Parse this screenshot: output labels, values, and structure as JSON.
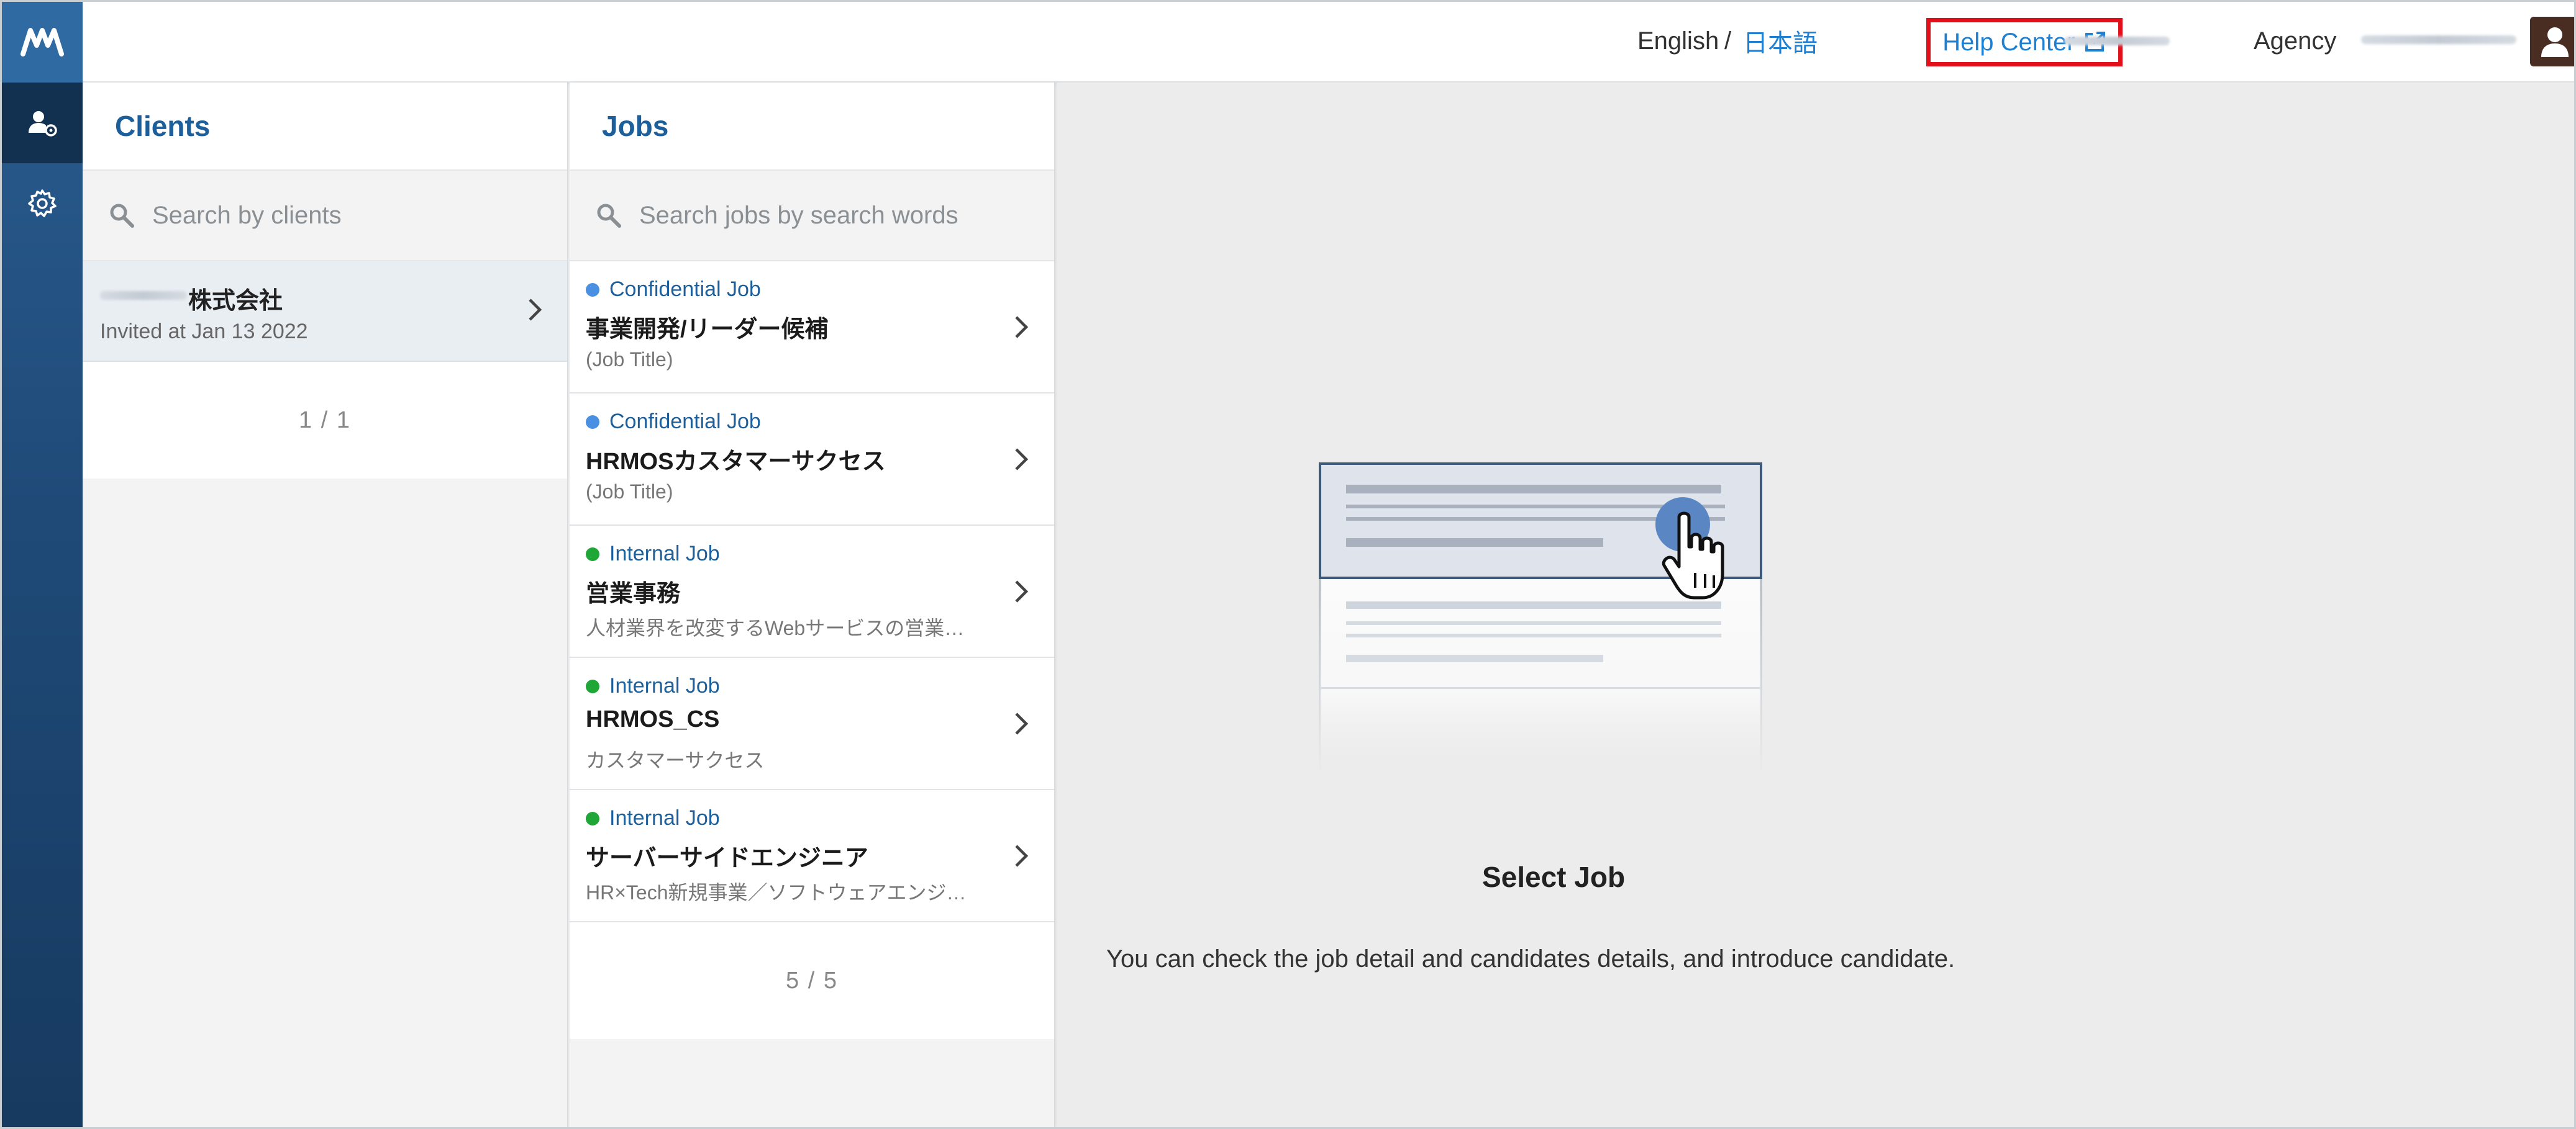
{
  "header": {
    "lang_english": "English",
    "lang_separator": "/",
    "lang_japanese": "日本語",
    "help_center": "Help Center",
    "agency_label": "Agency"
  },
  "nav": {
    "items": [
      {
        "name": "clients-icon",
        "active": true
      },
      {
        "name": "gear-icon",
        "active": false
      }
    ]
  },
  "clients": {
    "title": "Clients",
    "search_placeholder": "Search by clients",
    "items": [
      {
        "name": "株式会社",
        "invited": "Invited at Jan 13 2022"
      }
    ],
    "pager": "1 / 1"
  },
  "jobs": {
    "title": "Jobs",
    "search_placeholder": "Search jobs by search words",
    "items": [
      {
        "type": "Confidential Job",
        "type_color": "#4a90e2",
        "title": "事業開発/リーダー候補",
        "sub": "(Job Title)"
      },
      {
        "type": "Confidential Job",
        "type_color": "#4a90e2",
        "title": "HRMOSカスタマーサクセス",
        "sub": "(Job Title)"
      },
      {
        "type": "Internal Job",
        "type_color": "#1ea637",
        "title": "営業事務",
        "sub": "人材業界を改変するWebサービスの営業…"
      },
      {
        "type": "Internal Job",
        "type_color": "#1ea637",
        "title": "HRMOS_CS",
        "sub": "カスタマーサクセス"
      },
      {
        "type": "Internal Job",
        "type_color": "#1ea637",
        "title": "サーバーサイドエンジニア",
        "sub": "HR×Tech新規事業／ソフトウェアエンジ…"
      }
    ],
    "pager": "5 / 5"
  },
  "detail": {
    "title": "Select Job",
    "description": "You can check the job detail and candidates details, and introduce candidate."
  },
  "colors": {
    "accent": "#1d5f9a",
    "link": "#1f7fd1",
    "help_highlight": "#e3101c",
    "confidential": "#4a90e2",
    "internal": "#1ea637"
  }
}
